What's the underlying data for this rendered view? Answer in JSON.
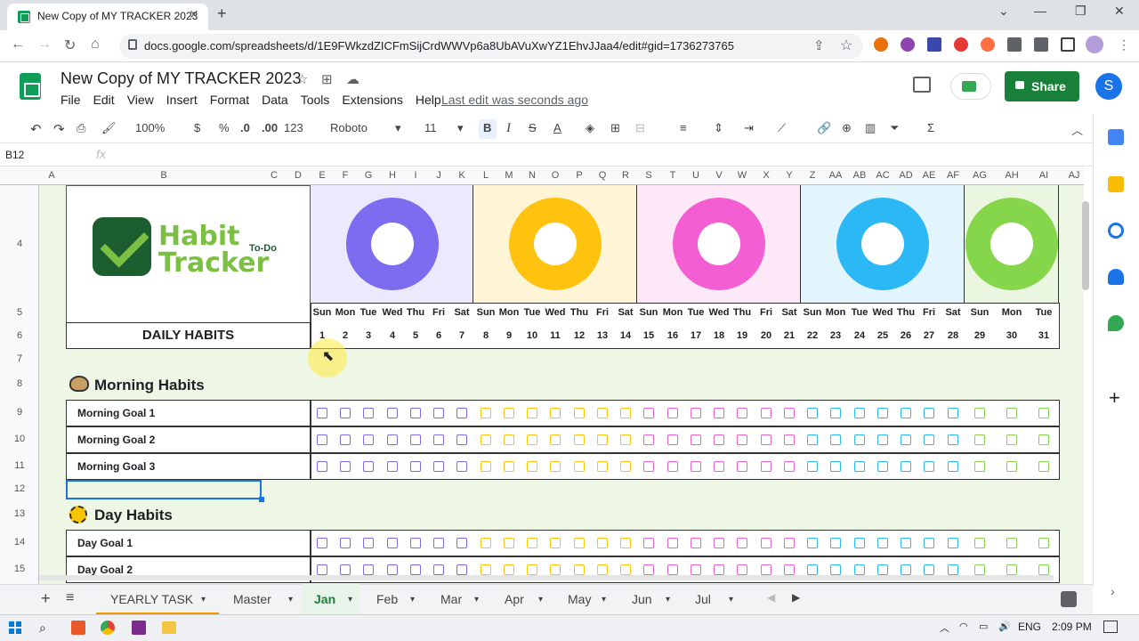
{
  "browser": {
    "tab_title": "New Copy of MY TRACKER 2023",
    "url": "docs.google.com/spreadsheets/d/1E9FWkzdZICFmSijCrdWWVp6a8UbAVuXwYZ1EhvJJaa4/edit#gid=1736273765"
  },
  "sheets": {
    "doc_title": "New Copy of MY TRACKER 2023",
    "menu": [
      "File",
      "Edit",
      "View",
      "Insert",
      "Format",
      "Data",
      "Tools",
      "Extensions",
      "Help"
    ],
    "last_edit": "Last edit was seconds ago",
    "share_label": "Share",
    "avatar_letter": "S"
  },
  "toolbar": {
    "zoom": "100%",
    "currency": "$",
    "percent": "%",
    "dec_less": ".0",
    "dec_more": ".00",
    "format_more": "123",
    "font": "Roboto",
    "font_size": "11"
  },
  "formula_bar": {
    "name_box": "B12",
    "fx": "fx"
  },
  "columns": [
    "A",
    "B",
    "C",
    "D",
    "E",
    "F",
    "G",
    "H",
    "I",
    "J",
    "K",
    "L",
    "M",
    "N",
    "O",
    "P",
    "Q",
    "R",
    "S",
    "T",
    "U",
    "V",
    "W",
    "X",
    "Y",
    "Z",
    "AA",
    "AB",
    "AC",
    "AD",
    "AE",
    "AF",
    "AG",
    "AH",
    "AI",
    "AJ"
  ],
  "rows": [
    "4",
    "5",
    "6",
    "7",
    "8",
    "9",
    "10",
    "11",
    "12",
    "13",
    "14",
    "15"
  ],
  "logo": {
    "line1": "Habit",
    "line2": "Tracker",
    "tag": "To-Do"
  },
  "daily_habits_label": "DAILY HABITS",
  "day_names": [
    "Sun",
    "Mon",
    "Tue",
    "Wed",
    "Thu",
    "Fri",
    "Sat",
    "Sun",
    "Mon",
    "Tue",
    "Wed",
    "Thu",
    "Fri",
    "Sat",
    "Sun",
    "Mon",
    "Tue",
    "Wed",
    "Thu",
    "Fri",
    "Sat",
    "Sun",
    "Mon",
    "Tue",
    "Wed",
    "Thu",
    "Fri",
    "Sat",
    "Sun",
    "Mon",
    "Tue"
  ],
  "day_numbers": [
    "1",
    "2",
    "3",
    "4",
    "5",
    "6",
    "7",
    "8",
    "9",
    "10",
    "11",
    "12",
    "13",
    "14",
    "15",
    "16",
    "17",
    "18",
    "19",
    "20",
    "21",
    "22",
    "23",
    "24",
    "25",
    "26",
    "27",
    "28",
    "29",
    "30",
    "31"
  ],
  "week_colors": [
    "#7b6cf0",
    "#ffc20e",
    "#f35fd2",
    "#2bb8f5",
    "#85d64a"
  ],
  "sections": {
    "morning": {
      "title": "Morning Habits",
      "goals": [
        "Morning Goal 1",
        "Morning Goal 2",
        "Morning Goal 3"
      ]
    },
    "day": {
      "title": "Day Habits",
      "goals": [
        "Day Goal 1",
        "Day Goal 2"
      ]
    }
  },
  "sheet_tabs": [
    "YEARLY TASK",
    "Master",
    "Jan",
    "Feb",
    "Mar",
    "Apr",
    "May",
    "Jun",
    "Jul"
  ],
  "active_sheet": "Jan",
  "taskbar": {
    "lang": "ENG",
    "time": "2:09 PM"
  }
}
